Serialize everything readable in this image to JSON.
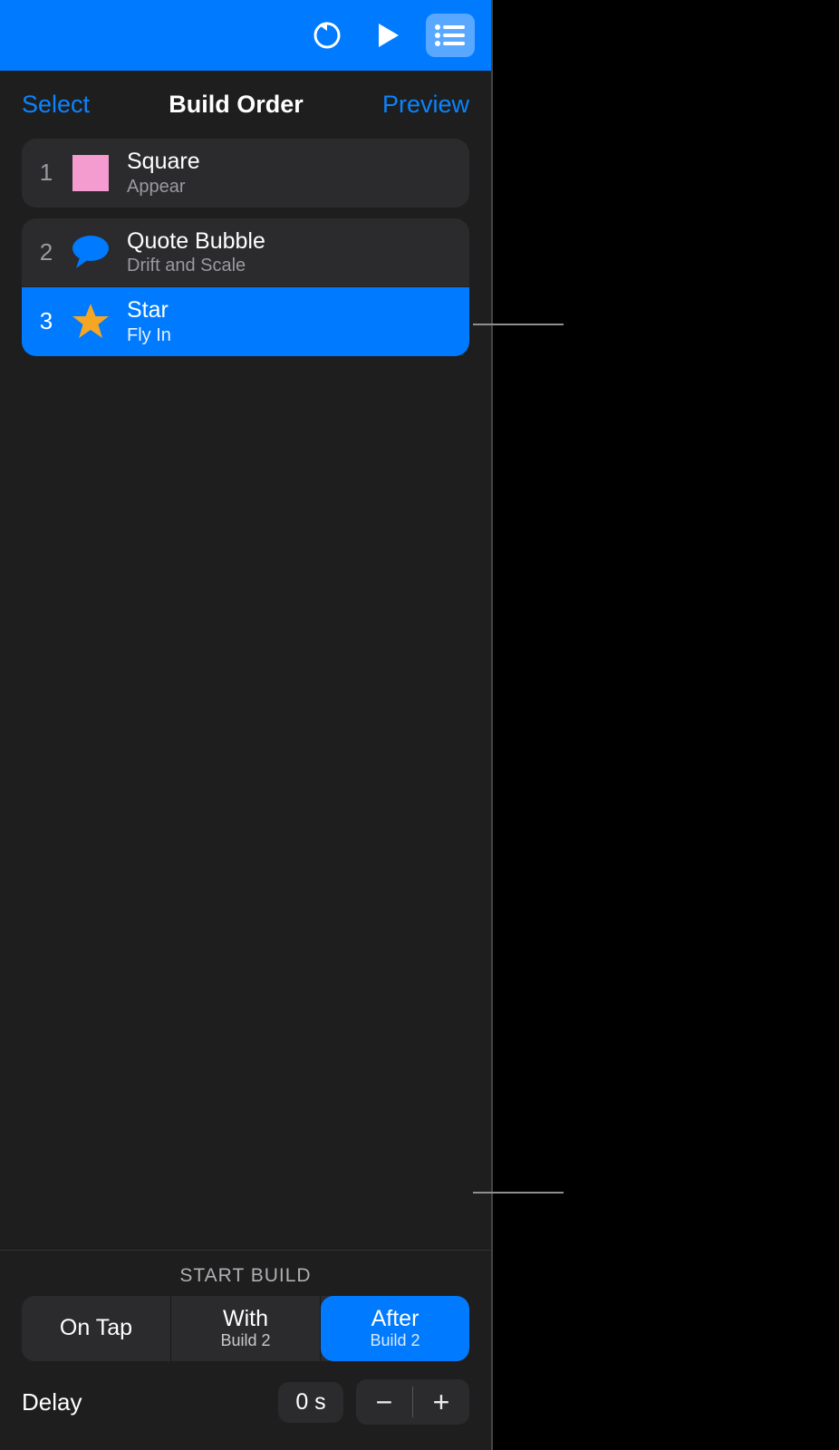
{
  "toolbar": {
    "undo_name": "undo-icon",
    "play_name": "play-icon",
    "list_name": "list-icon"
  },
  "header": {
    "select_label": "Select",
    "title": "Build Order",
    "preview_label": "Preview"
  },
  "builds": [
    {
      "num": "1",
      "title": "Square",
      "effect": "Appear",
      "icon": "square-pink",
      "selected": false
    },
    {
      "num": "2",
      "title": "Quote Bubble",
      "effect": "Drift and Scale",
      "icon": "speech-bubble",
      "selected": false
    },
    {
      "num": "3",
      "title": "Star",
      "effect": "Fly In",
      "icon": "star",
      "selected": true
    }
  ],
  "start_build": {
    "label": "START BUILD",
    "options": [
      {
        "main": "On Tap",
        "sub": "",
        "selected": false
      },
      {
        "main": "With",
        "sub": "Build 2",
        "selected": false
      },
      {
        "main": "After",
        "sub": "Build 2",
        "selected": true
      }
    ]
  },
  "delay": {
    "label": "Delay",
    "value": "0 s",
    "minus": "−",
    "plus": "+"
  }
}
